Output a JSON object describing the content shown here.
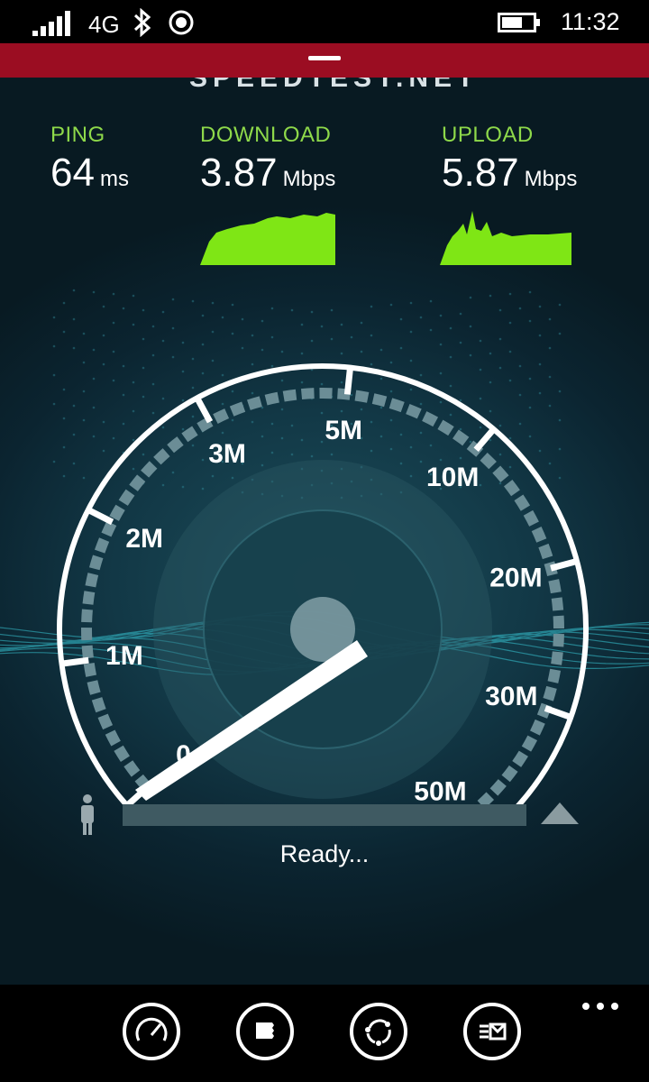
{
  "status_bar": {
    "network": "4G",
    "time": "11:32",
    "icons": [
      "signal-icon",
      "bluetooth-icon",
      "location-icon",
      "battery-icon"
    ]
  },
  "app": {
    "logo_partial": "SPEEDTEST.NET"
  },
  "metrics": {
    "ping": {
      "label": "PING",
      "value": "64",
      "unit": "ms"
    },
    "download": {
      "label": "DOWNLOAD",
      "value": "3.87",
      "unit": "Mbps"
    },
    "upload": {
      "label": "UPLOAD",
      "value": "5.87",
      "unit": "Mbps"
    }
  },
  "gauge": {
    "ticks": [
      "0",
      "1M",
      "2M",
      "3M",
      "5M",
      "10M",
      "20M",
      "30M",
      "50M"
    ],
    "needle_value": "0"
  },
  "test": {
    "status": "Ready...",
    "progress": 0
  },
  "app_bar": {
    "buttons": [
      "speedometer-icon",
      "results-icon",
      "share-icon",
      "feedback-icon"
    ],
    "more": "more-icon"
  },
  "colors": {
    "accent_red": "#9b0d22",
    "metric_green": "#8ed94a",
    "graph_green": "#7fe615"
  }
}
